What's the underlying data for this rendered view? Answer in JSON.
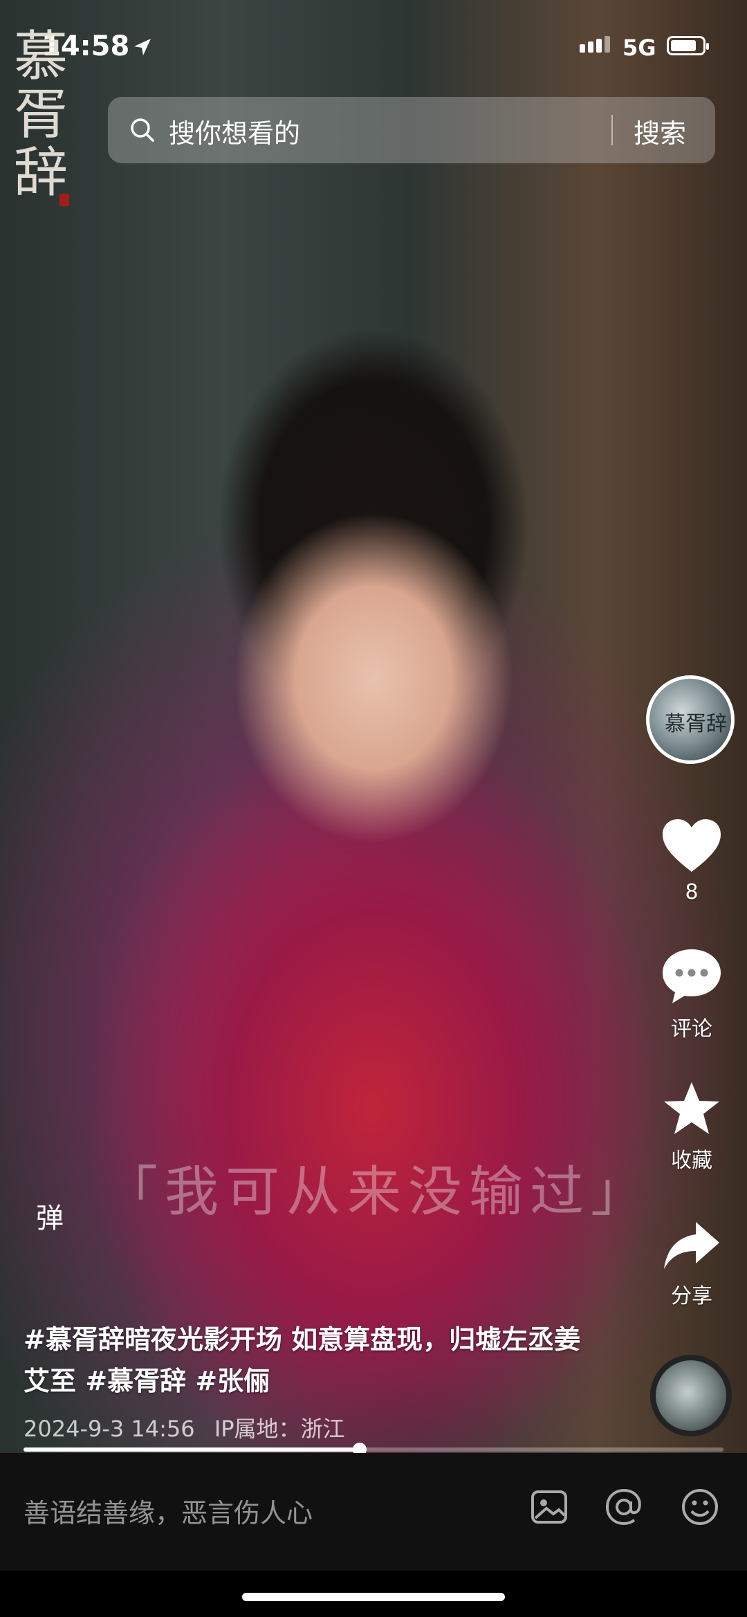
{
  "status_bar": {
    "time": "14:58",
    "network": "5G"
  },
  "logo": {
    "text": "慕胥辞"
  },
  "search": {
    "placeholder": "搜你想看的",
    "button": "搜索"
  },
  "side_actions": {
    "avatar_text": "慕胥辞",
    "like_count": "8",
    "comment_label": "评论",
    "favorite_label": "收藏",
    "share_label": "分享"
  },
  "video": {
    "subtitle": "「我可从来没输过」",
    "danmu_label": "弹"
  },
  "post": {
    "caption": "#慕胥辞暗夜光影开场 如意算盘现，归墟左丞姜艾至 #慕胥辞 #张俪",
    "date": "2024-9-3 14:56",
    "ip_location": "IP属地：浙江"
  },
  "playback": {
    "progress": 0.48
  },
  "comment_bar": {
    "placeholder": "善语结善缘，恶言伤人心"
  },
  "icons": [
    "location-arrow-icon",
    "signal-icon",
    "battery-icon",
    "search-icon",
    "heart-icon",
    "comment-icon",
    "star-icon",
    "share-icon",
    "image-icon",
    "at-icon",
    "emoji-icon"
  ]
}
